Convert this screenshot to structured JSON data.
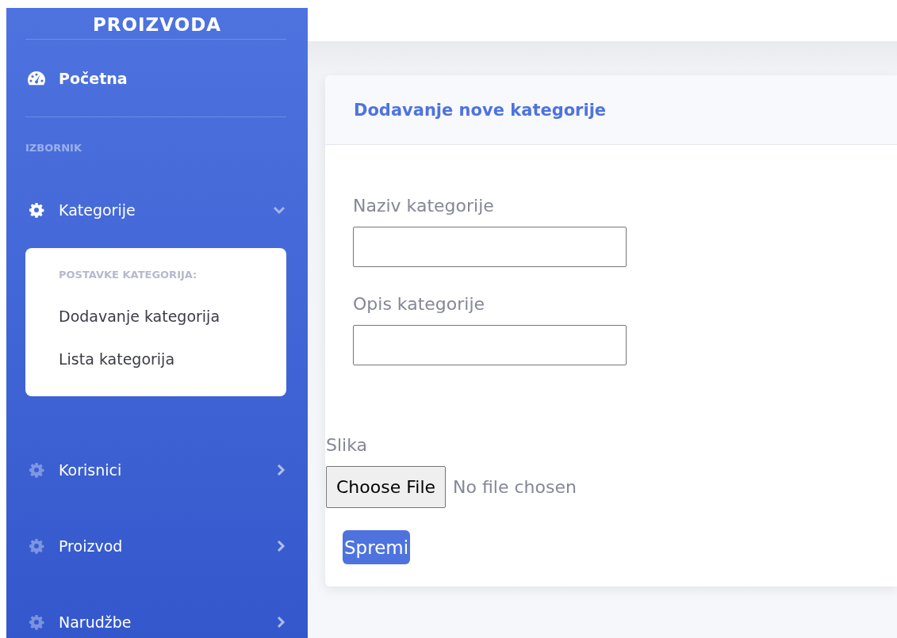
{
  "sidebar": {
    "brand": "PROIZVODA",
    "items_top": [
      {
        "label": "Početna",
        "kind": "link"
      }
    ],
    "heading": "IZBORNIK",
    "items": [
      {
        "label": "Kategorije",
        "kind": "collapse",
        "expanded": true,
        "submenu": {
          "heading": "POSTAVKE KATEGORIJA:",
          "links": [
            "Dodavanje kategorija",
            "Lista kategorija"
          ]
        }
      },
      {
        "label": "Korisnici",
        "kind": "collapse",
        "expanded": false
      },
      {
        "label": "Proizvod",
        "kind": "collapse",
        "expanded": false
      },
      {
        "label": "Narudžbe",
        "kind": "collapse",
        "expanded": false
      }
    ]
  },
  "card": {
    "title": "Dodavanje nove kategorije",
    "fields": [
      {
        "label": "Naziv kategorije"
      },
      {
        "label": "Opis kategorije"
      }
    ],
    "file": {
      "label": "Slika",
      "button": "Choose File",
      "status": "No file chosen"
    },
    "submit": "Spremi"
  }
}
